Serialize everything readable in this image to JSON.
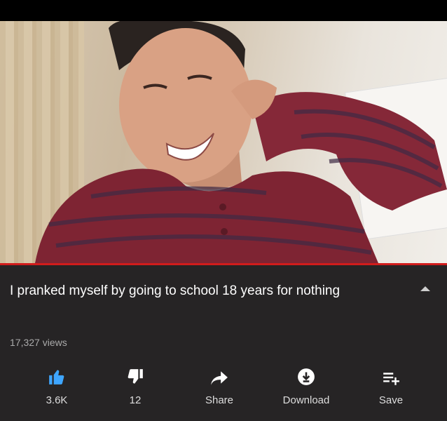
{
  "video": {
    "title": "I pranked myself by going to school 18 years for nothing",
    "views": "17,327 views",
    "progress_fraction": 1.0
  },
  "actions": {
    "like_count": "3.6K",
    "dislike_count": "12",
    "share_label": "Share",
    "download_label": "Download",
    "save_label": "Save"
  },
  "colors": {
    "like_active": "#3ea6ff",
    "progress": "#d11c1c",
    "panel_bg": "#262425"
  }
}
